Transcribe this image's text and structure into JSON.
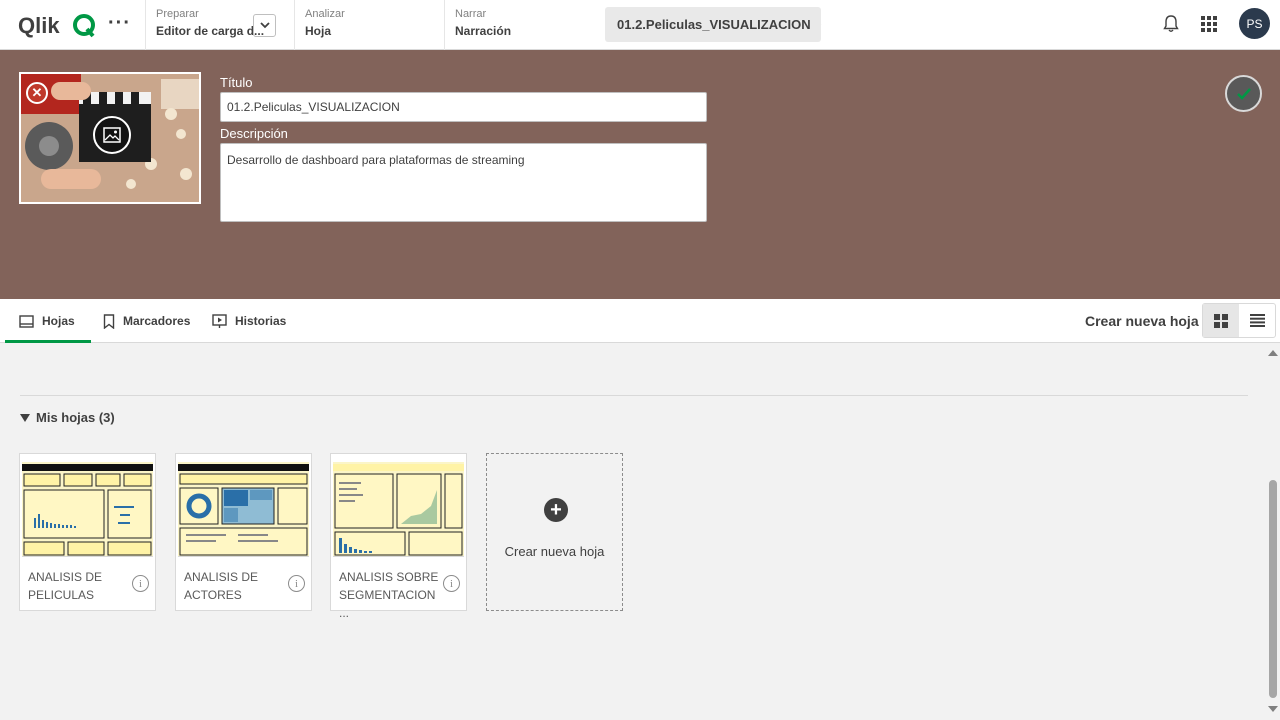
{
  "topbar": {
    "logo_text": "Qlik",
    "prepare": {
      "small": "Preparar",
      "big": "Editor de carga d..."
    },
    "analyze": {
      "small": "Analizar",
      "big": "Hoja"
    },
    "narrate": {
      "small": "Narrar",
      "big": "Narración"
    },
    "app_title": "01.2.Peliculas_VISUALIZACION",
    "avatar": "PS",
    "accent_color": "#009845"
  },
  "header": {
    "title_label": "Título",
    "title_value": "01.2.Peliculas_VISUALIZACION",
    "description_label": "Descripción",
    "description_value": "Desarrollo de dashboard para plataformas de streaming",
    "background_color": "#82635a"
  },
  "tabs": [
    {
      "label": "Hojas",
      "icon": "sheet-icon",
      "active": true
    },
    {
      "label": "Marcadores",
      "icon": "bookmark-icon",
      "active": false
    },
    {
      "label": "Historias",
      "icon": "story-icon",
      "active": false
    }
  ],
  "toolbar": {
    "create_sheet": "Crear nueva hoja"
  },
  "section": {
    "title": "Mis hojas (3)"
  },
  "sheets": [
    {
      "name": "ANALISIS DE PELICULAS"
    },
    {
      "name": "ANALISIS DE ACTORES"
    },
    {
      "name": "ANALISIS SOBRE SEGMENTACION ..."
    }
  ],
  "new_sheet": {
    "label": "Crear nueva hoja"
  }
}
